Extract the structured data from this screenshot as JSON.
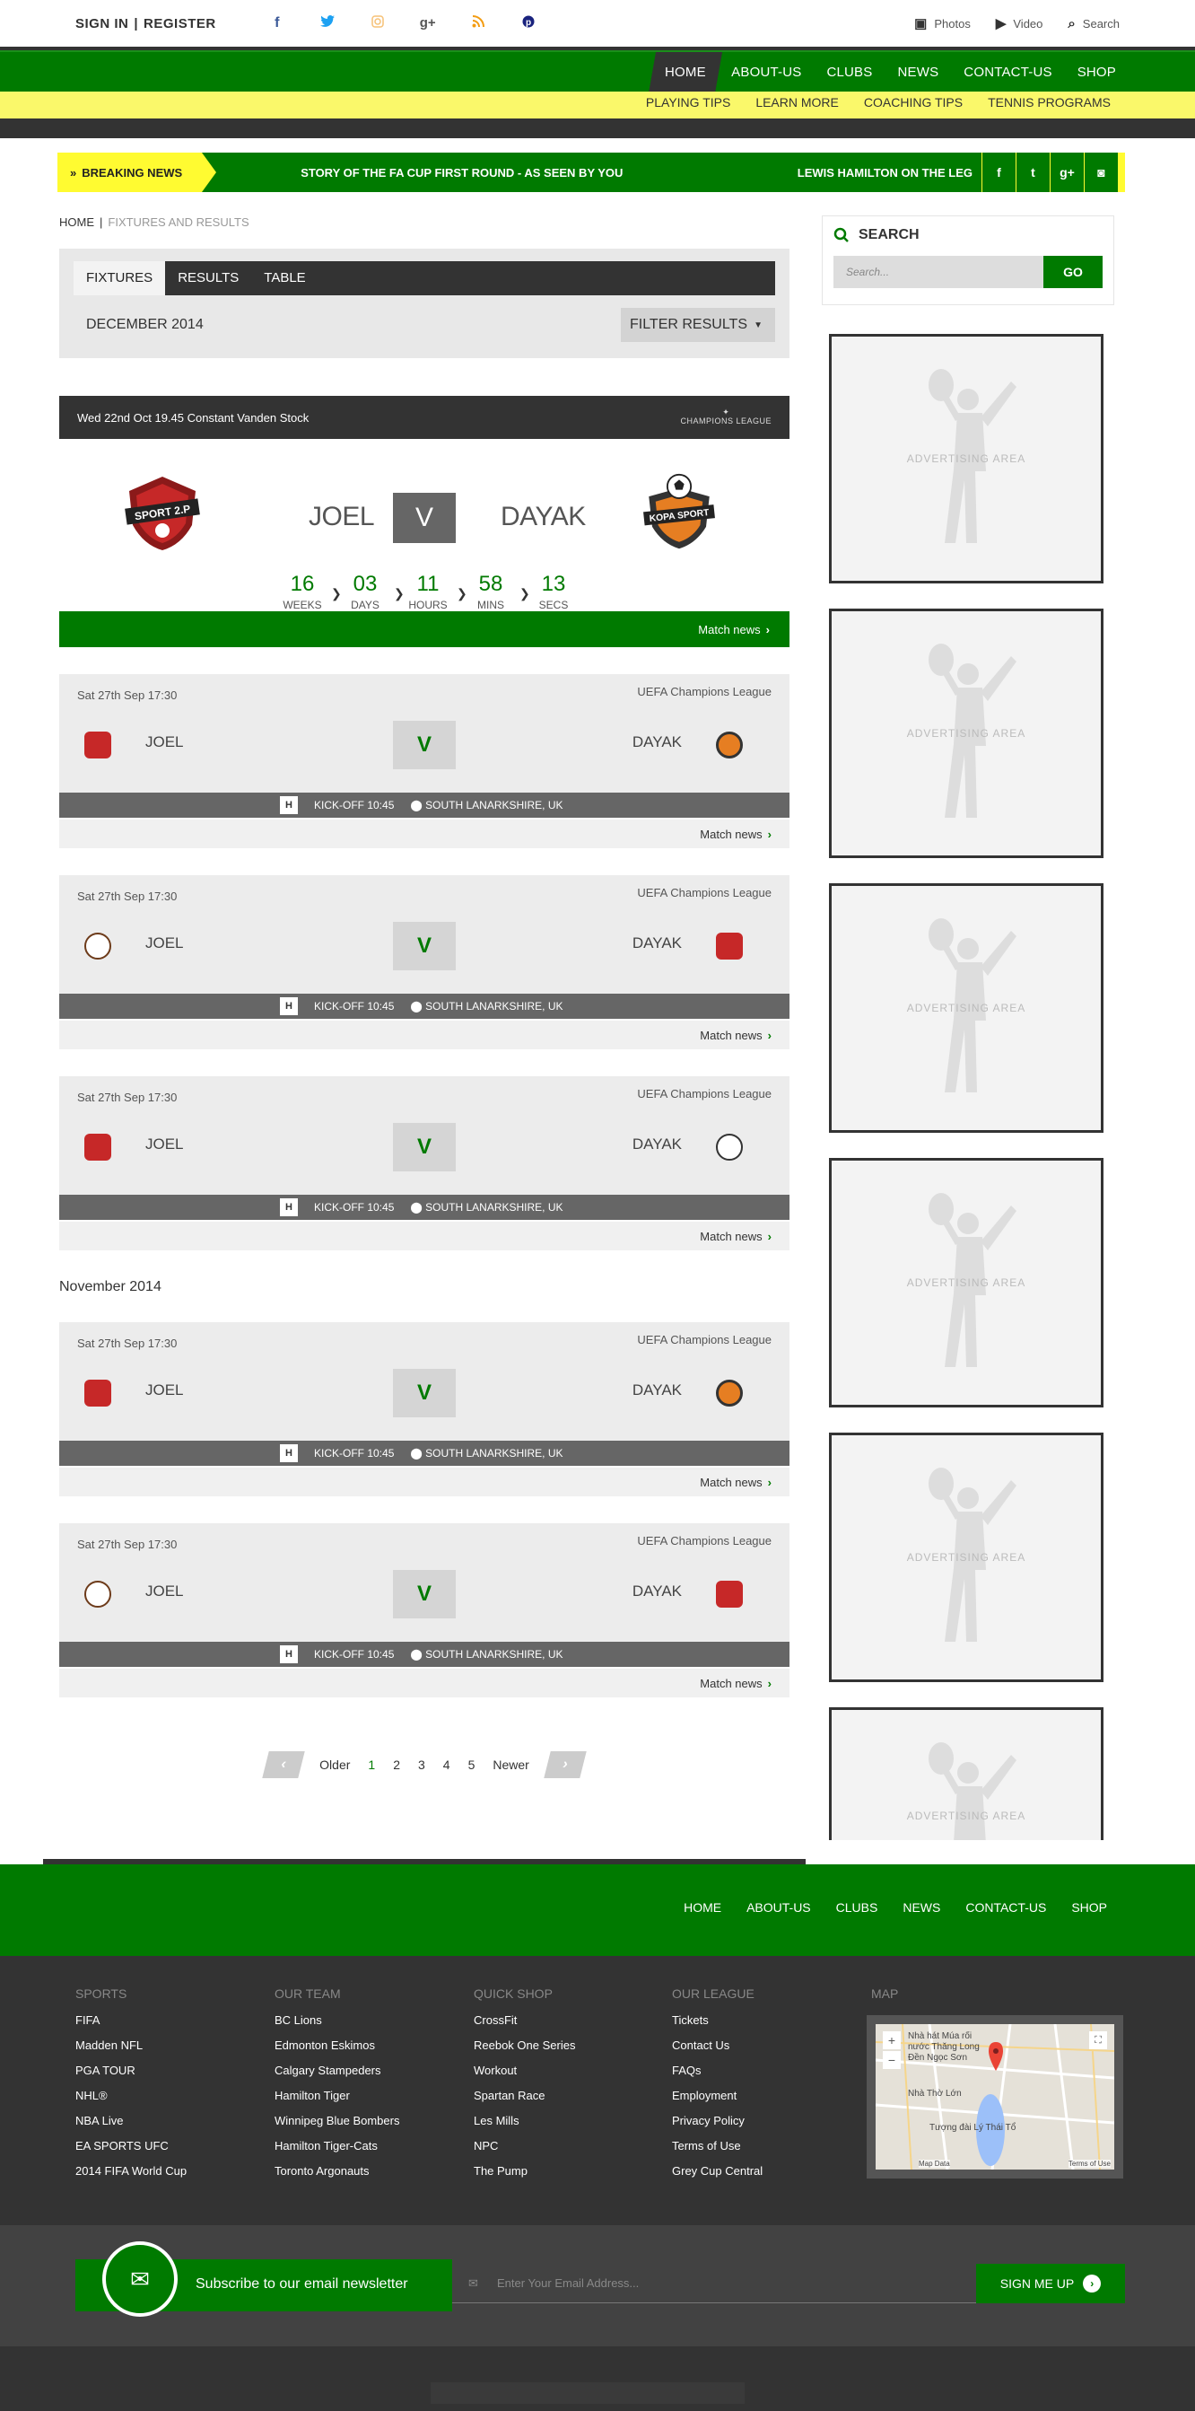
{
  "header": {
    "sign_in": "SIGN IN",
    "register": "REGISTER",
    "social": [
      "f",
      "t",
      "ig",
      "g+",
      "rss",
      "p"
    ],
    "right": [
      {
        "icon": "photo-icon",
        "label": "Photos"
      },
      {
        "icon": "video-icon",
        "label": "Video"
      },
      {
        "icon": "search-icon",
        "label": "Search"
      }
    ]
  },
  "nav": {
    "items": [
      "HOME",
      "ABOUT-US",
      "CLUBS",
      "NEWS",
      "CONTACT-US",
      "SHOP"
    ]
  },
  "subnav": {
    "items": [
      "PLAYING TIPS",
      "LEARN MORE",
      "COACHING TIPS",
      "TENNIS PROGRAMS"
    ]
  },
  "breaking": {
    "label": "BREAKING NEWS",
    "text1": "STORY OF THE FA CUP FIRST ROUND - AS SEEN BY YOU",
    "text2": "LEWIS HAMILTON ON THE LEG"
  },
  "crumb": {
    "home": "HOME",
    "current": "FIXTURES AND RESULTS"
  },
  "tabs": [
    "FIXTURES",
    "RESULTS",
    "TABLE"
  ],
  "month": "DECEMBER 2014",
  "filter": "FILTER RESULTS",
  "featured": {
    "info": "Wed 22nd Oct 19.45 Constant Vanden Stock",
    "league_logo": "CHAMPIONS LEAGUE",
    "team1": "JOEL",
    "team2": "DAYAK",
    "vs": "V",
    "badge1": "SPORT 2.P",
    "badge2": "KOPA SPORT",
    "countdown": [
      {
        "n": "16",
        "l": "WEEKS"
      },
      {
        "n": "03",
        "l": "DAYS"
      },
      {
        "n": "11",
        "l": "HOURS"
      },
      {
        "n": "58",
        "l": "MINS"
      },
      {
        "n": "13",
        "l": "SECS"
      }
    ],
    "match_news": "Match news"
  },
  "matches": [
    {
      "date": "Sat 27th Sep 17:30",
      "comp": "UEFA Champions League",
      "t1": "JOEL",
      "t2": "DAYAK",
      "v": "V",
      "h": "H",
      "kick": "KICK-OFF 10:45",
      "loc": "SOUTH LANARKSHIRE, UK",
      "news": "Match news"
    },
    {
      "date": "Sat 27th Sep 17:30",
      "comp": "UEFA Champions League",
      "t1": "JOEL",
      "t2": "DAYAK",
      "v": "V",
      "h": "H",
      "kick": "KICK-OFF 10:45",
      "loc": "SOUTH LANARKSHIRE, UK",
      "news": "Match news"
    },
    {
      "date": "Sat 27th Sep 17:30",
      "comp": "UEFA Champions League",
      "t1": "JOEL",
      "t2": "DAYAK",
      "v": "V",
      "h": "H",
      "kick": "KICK-OFF 10:45",
      "loc": "SOUTH LANARKSHIRE, UK",
      "news": "Match news"
    },
    {
      "date": "Sat 27th Sep 17:30",
      "comp": "UEFA Champions League",
      "t1": "JOEL",
      "t2": "DAYAK",
      "v": "V",
      "h": "H",
      "kick": "KICK-OFF 10:45",
      "loc": "SOUTH LANARKSHIRE, UK",
      "news": "Match news"
    },
    {
      "date": "Sat 27th Sep 17:30",
      "comp": "UEFA Champions League",
      "t1": "JOEL",
      "t2": "DAYAK",
      "v": "V",
      "h": "H",
      "kick": "KICK-OFF 10:45",
      "loc": "SOUTH LANARKSHIRE, UK",
      "news": "Match news"
    }
  ],
  "november": "November 2014",
  "pagination": {
    "older": "Older",
    "pages": [
      "1",
      "2",
      "3",
      "4",
      "5"
    ],
    "newer": "Newer"
  },
  "sidebar": {
    "search_title": "SEARCH",
    "search_placeholder": "Search...",
    "go": "GO",
    "ad_text": "ADVERTISING AREA"
  },
  "footer": {
    "nav": [
      "HOME",
      "ABOUT-US",
      "CLUBS",
      "NEWS",
      "CONTACT-US",
      "SHOP"
    ],
    "cols": [
      {
        "title": "SPORTS",
        "items": [
          "FIFA",
          "Madden NFL",
          "PGA TOUR",
          "NHL®",
          "NBA Live",
          "EA SPORTS UFC",
          "2014 FIFA World Cup"
        ]
      },
      {
        "title": "OUR TEAM",
        "items": [
          "BC Lions",
          "Edmonton Eskimos",
          "Calgary Stampeders",
          "Hamilton Tiger",
          "Winnipeg Blue Bombers",
          "Hamilton Tiger-Cats",
          "Toronto Argonauts"
        ]
      },
      {
        "title": "QUICK SHOP",
        "items": [
          "CrossFit",
          "Reebok One Series",
          "Workout",
          "Spartan Race",
          "Les Mills",
          "NPC",
          "The Pump"
        ]
      },
      {
        "title": "OUR LEAGUE",
        "items": [
          "Tickets",
          "Contact Us",
          "FAQs",
          "Employment",
          "Privacy Policy",
          "Terms of Use",
          "Grey Cup Central"
        ]
      }
    ],
    "map_title": "MAP",
    "map_labels": [
      "Nhà hát Múa rối",
      "nước Thăng Long",
      "Đền Ngọc Sơn",
      "Nhà Thờ Lớn",
      "Tượng đài Lý Thái Tổ",
      "Map Data",
      "Terms of Use"
    ],
    "newsletter": "Subscribe to our email newsletter",
    "email_placeholder": "Enter Your Email Address...",
    "signup": "SIGN ME UP"
  },
  "colors": {
    "green": "#007a00",
    "yellow": "#fffb31",
    "dark": "#333333"
  }
}
